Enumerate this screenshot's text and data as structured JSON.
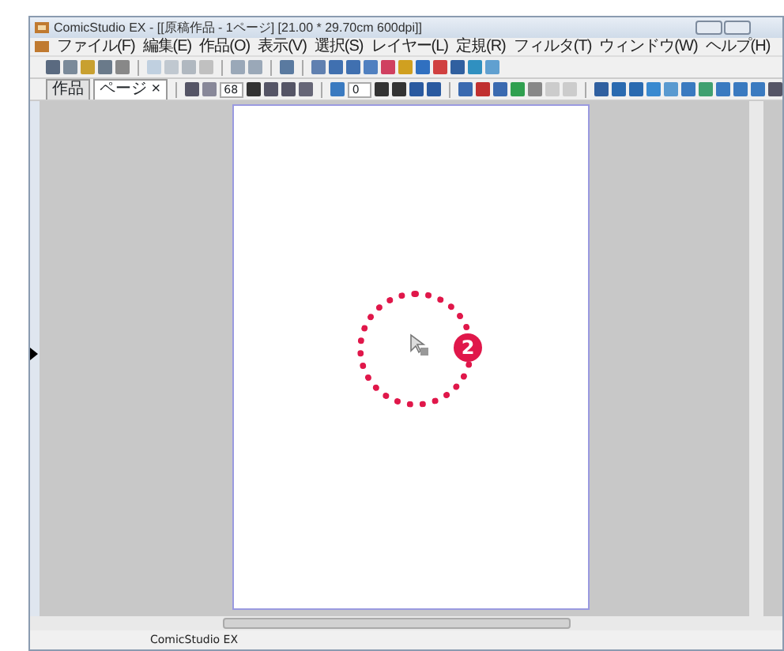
{
  "window": {
    "title": "ComicStudio EX - [[原稿作品 - 1ページ] [21.00 * 29.70cm 600dpi]]"
  },
  "menu": [
    {
      "label": "ファイル(F)"
    },
    {
      "label": "編集(E)"
    },
    {
      "label": "作品(O)"
    },
    {
      "label": "表示(V)"
    },
    {
      "label": "選択(S)"
    },
    {
      "label": "レイヤー(L)"
    },
    {
      "label": "定規(R)"
    },
    {
      "label": "フィルタ(T)"
    },
    {
      "label": "ウィンドウ(W)"
    },
    {
      "label": "ヘルプ(H)"
    }
  ],
  "panel_tabs": [
    {
      "label": "作品",
      "selected": false
    },
    {
      "label": "ページ",
      "selected": true,
      "close": "×"
    }
  ],
  "toolbar_fields": [
    {
      "value": "68"
    },
    {
      "value": "0"
    }
  ],
  "annotation": {
    "number": "2"
  },
  "status_bar": {
    "text": "ComicStudio EX"
  }
}
